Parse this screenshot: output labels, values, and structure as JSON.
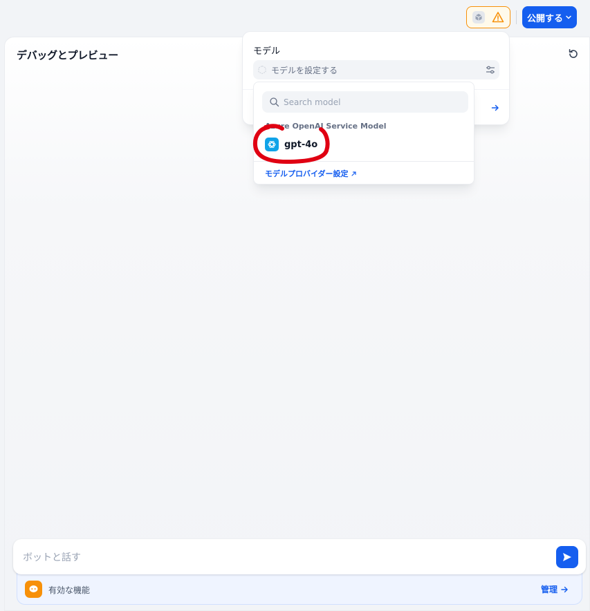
{
  "header": {
    "publish_label": "公開する"
  },
  "panel": {
    "title": "デバッグとプレビュー"
  },
  "chat": {
    "placeholder": "ボットと話す"
  },
  "features": {
    "label": "有効な機能",
    "manage_label": "管理"
  },
  "model_popover": {
    "label": "モデル",
    "select_placeholder": "モデルを設定する"
  },
  "model_dropdown": {
    "search_placeholder": "Search model",
    "provider_name": "Azure OpenAI Service Model",
    "models": [
      {
        "label": "gpt-4o",
        "icon": "openai-icon"
      }
    ],
    "provider_settings_label": "モデルプロバイダー設定"
  },
  "colors": {
    "primary": "#155eef",
    "warning": "#f79009",
    "annotation": "#e00012",
    "openai_badge": "#10a3e8"
  }
}
